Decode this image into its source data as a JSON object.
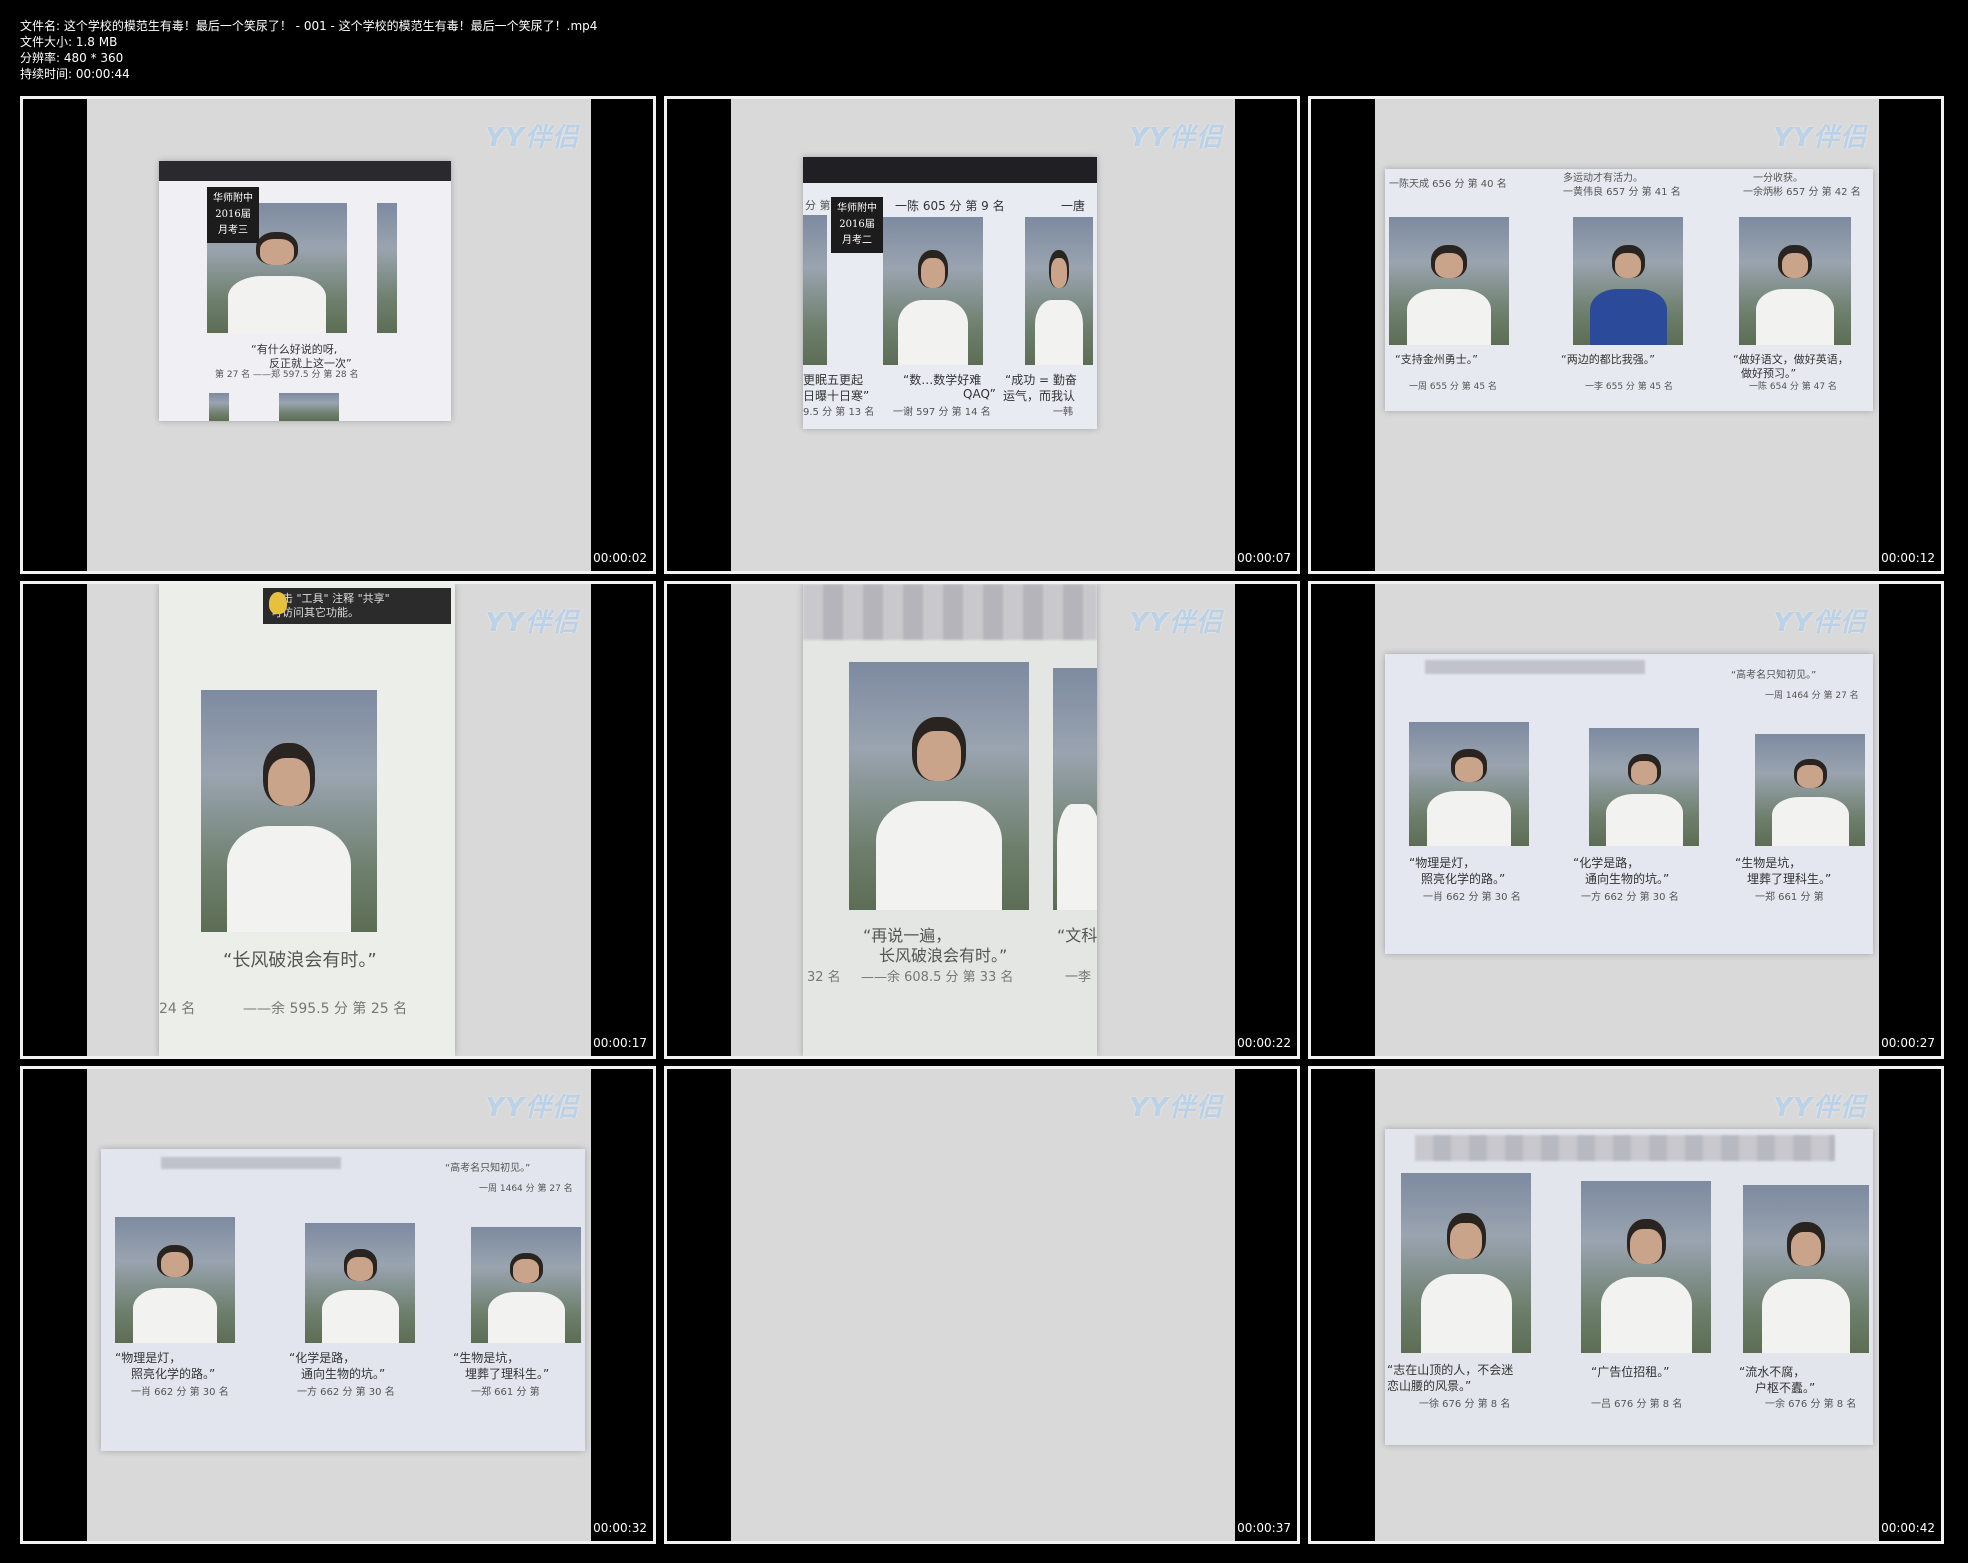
{
  "header": {
    "filename": "文件名: 这个学校的模范生有毒！最后一个笑尿了！ - 001 - 这个学校的模范生有毒！最后一个笑尿了！.mp4",
    "filesize": "文件大小: 1.8 MB",
    "resolution": "分辨率: 480 * 360",
    "duration": "持续时间: 00:00:44"
  },
  "watermark": "YY伴侣",
  "frames": [
    {
      "timestamp": "00:00:02",
      "badge": [
        "华师附中",
        "2016届",
        "月考三"
      ],
      "quote": [
        "“有什么好说的呀,",
        "反正就上这一次”"
      ],
      "caption_left": "第 27 名",
      "caption": "——郑  597.5 分 第 28 名"
    },
    {
      "timestamp": "00:00:07",
      "badge": [
        "华师附中",
        "2016届",
        "月考二"
      ],
      "top_text": "一陈  605 分 第 9 名",
      "top_right": "一唐",
      "top_left": "分 第",
      "quotes": [
        {
          "l1": "更眠五更起",
          "l2": "日曝十日寒”"
        },
        {
          "l1": "“数…数学好难",
          "l2": "QAQ”"
        },
        {
          "l1": "“成功 = 勤奋",
          "l2": "运气，而我认"
        }
      ],
      "scores": [
        "9.5 分 第 13 名",
        "一谢  597 分 第 14 名",
        "一韩"
      ]
    },
    {
      "timestamp": "00:00:12",
      "top_texts": [
        "一陈天成 656 分 第 40 名",
        "多运动才有活力。",
        "一黄伟良 657 分 第 41 名",
        "一分收获。",
        "一余炳彬 657 分 第 42 名"
      ],
      "quotes": [
        "“支持金州勇士。”",
        "“两边的都比我强。”",
        "“做好语文，做好英语，",
        "做好预习。”"
      ],
      "scores": [
        "一周  655 分 第 45 名",
        "一李  655 分 第 45 名",
        "一陈  654 分 第 47 名"
      ]
    },
    {
      "timestamp": "00:00:17",
      "tip": [
        "单击 \"工具\" 注释 \"共享\"",
        "可访问其它功能。"
      ],
      "quote": "“长风破浪会有时。”",
      "caption_left": "24 名",
      "caption": "——余  595.5 分 第 25 名"
    },
    {
      "timestamp": "00:00:22",
      "quote": [
        "“再说一遍，",
        "长风破浪会有时。”"
      ],
      "quote_right": "“文科不",
      "caption_left": "32 名",
      "caption": "——余  608.5 分 第 33 名",
      "caption_right": "一李"
    },
    {
      "timestamp": "00:00:27",
      "top_texts": [
        "“高考名只知初见。”",
        "一周  1464 分 第 27 名"
      ],
      "quotes": [
        {
          "l1": "“物理是灯，",
          "l2": "照亮化学的路。”"
        },
        {
          "l1": "“化学是路，",
          "l2": "通向生物的坑。”"
        },
        {
          "l1": "“生物是坑，",
          "l2": "埋葬了理科生。”"
        }
      ],
      "scores": [
        "一肖  662 分 第 30 名",
        "一方  662 分 第 30 名",
        "一郑  661 分 第"
      ]
    },
    {
      "timestamp": "00:00:32",
      "top_texts": [
        "“高考名只知初见。”",
        "一周  1464 分 第 27 名"
      ],
      "quotes": [
        {
          "l1": "“物理是灯，",
          "l2": "照亮化学的路。”"
        },
        {
          "l1": "“化学是路，",
          "l2": "通向生物的坑。”"
        },
        {
          "l1": "“生物是坑，",
          "l2": "埋葬了理科生。”"
        }
      ],
      "scores": [
        "一肖  662 分 第 30 名",
        "一方  662 分 第 30 名",
        "一郑  661 分 第"
      ]
    },
    {
      "timestamp": "00:00:37"
    },
    {
      "timestamp": "00:00:42",
      "quotes": [
        {
          "l1": "“志在山顶的人，不会迷",
          "l2": "恋山腰的风景。”"
        },
        {
          "l1": "“广告位招租。”",
          "l2": ""
        },
        {
          "l1": "“流水不腐，",
          "l2": "户枢不蠹。”"
        }
      ],
      "scores": [
        "一徐  676 分 第 8 名",
        "一吕  676 分 第 8 名",
        "一余  676 分 第 8 名"
      ]
    }
  ]
}
